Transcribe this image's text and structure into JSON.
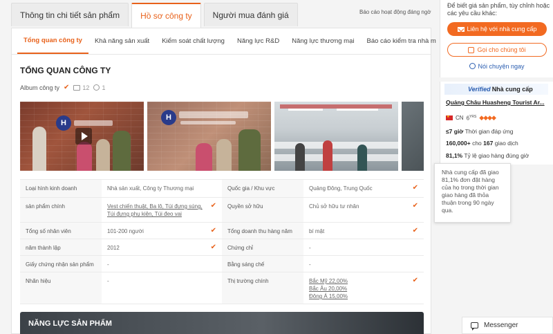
{
  "top_tabs": [
    {
      "label": "Thông tin chi tiết sản phẩm"
    },
    {
      "label": "Hồ sơ công ty"
    },
    {
      "label": "Người mua đánh giá"
    }
  ],
  "report_link": "Báo cáo hoạt động đáng ngờ",
  "sub_tabs": [
    {
      "label": "Tổng quan công ty"
    },
    {
      "label": "Khả năng sản xuất"
    },
    {
      "label": "Kiểm soát chất lượng"
    },
    {
      "label": "Năng lực R&D"
    },
    {
      "label": "Năng lực thương mại"
    },
    {
      "label": "Báo cáo kiểm tra nhà m"
    }
  ],
  "section_title": "TỔNG QUAN CÔNG TY",
  "album": {
    "label": "Album công ty",
    "image_count": "12",
    "video_count": "1"
  },
  "info_rows": [
    {
      "l1": "Loại hình kinh doanh",
      "v1": "Nhà sản xuất, Công ty Thương mại",
      "l2": "Quốc gia / Khu vực",
      "v2": "Quảng Đông, Trung Quốc"
    },
    {
      "l1": "sản phẩm chính",
      "v1": "Vest chiến thuật, Ba lô, Túi đựng súng, Túi đựng phụ kiện, Túi đeo vai",
      "l2": "Quyền sở hữu",
      "v2": "Chủ sở hữu tư nhân"
    },
    {
      "l1": "Tổng số nhân viên",
      "v1": "101-200 người",
      "l2": "Tổng doanh thu hàng năm",
      "v2": "bí mật"
    },
    {
      "l1": "năm thành lập",
      "v1": "2012",
      "l2": "Chứng chỉ",
      "v2": "-"
    },
    {
      "l1": "Giấy chứng nhận sản phẩm",
      "v1": "-",
      "l2": "Bằng sáng chế",
      "v2": "-"
    },
    {
      "l1": "Nhãn hiệu",
      "v1": "-",
      "l2": "Thị trường chính",
      "v2": ""
    }
  ],
  "markets": [
    "Bắc Mỹ 22,00%",
    "Bắc Âu 20,00%",
    "Đông Á 15,00%"
  ],
  "product_banner": "NĂNG LỰC SẢN PHẨM",
  "contact": {
    "text": "Để biết giá sản phẩm, tùy chỉnh hoặc các yêu cầu khác:",
    "primary_btn": "Liên hệ với nhà cung cấp",
    "call_btn": "Gọi cho chúng tôi",
    "chat_link": "Nói chuyện ngay"
  },
  "supplier": {
    "verified_v": "V",
    "verified_mid": "erified",
    "verified_text": "Nhà cung cấp",
    "name": "Quảng Châu Huasheng Tourist Ar...",
    "country": "CN",
    "years": "6",
    "years_unit": "YRS",
    "response_value": "≤7 giờ",
    "response_label": "Thời gian đáp ứng",
    "tx_value": "160,000+",
    "tx_for": "cho",
    "tx_count": "167",
    "tx_label": "giao dịch",
    "ontime_value": "81,1%",
    "ontime_label": "Tỷ lệ giao hàng đúng giờ"
  },
  "tooltip": "Nhà cung cấp đã giao 81,1% đơn đặt hàng của họ trong thời gian giao hàng đã thỏa thuận trong 90 ngày qua.",
  "messenger": "Messenger",
  "colors": {
    "accent": "#e8611a",
    "link": "#2a5db0"
  }
}
